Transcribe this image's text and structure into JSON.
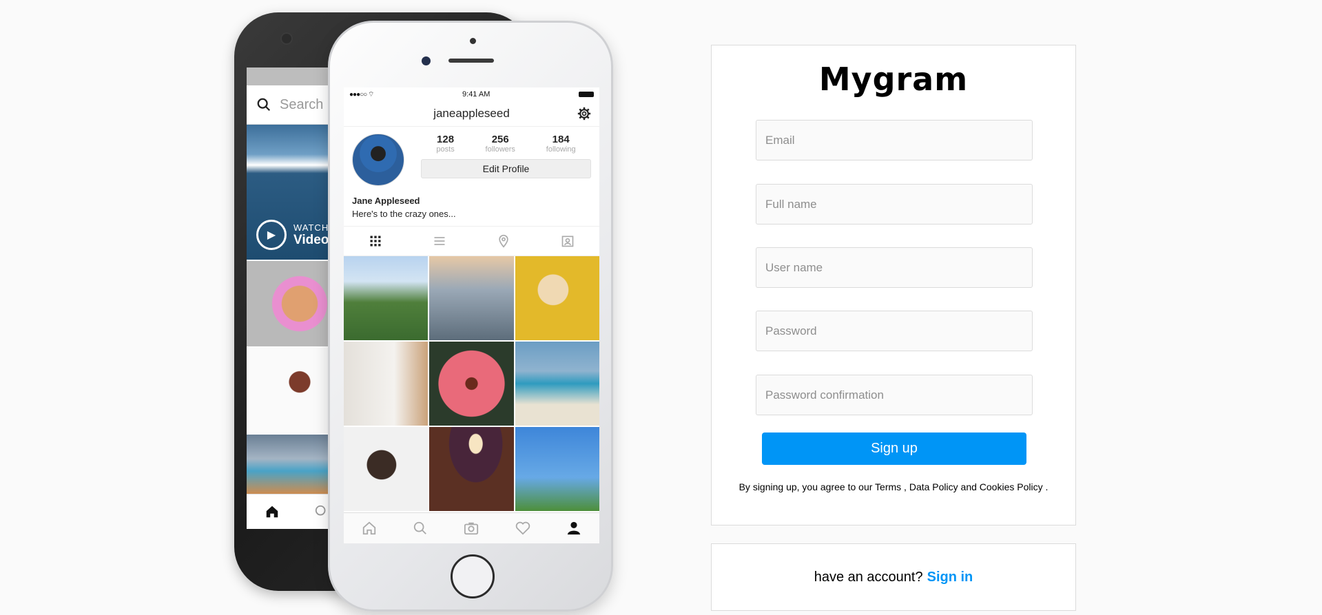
{
  "app": {
    "logo": "Mygram"
  },
  "phone_back": {
    "search_placeholder": "Search",
    "watch_small": "WATCH",
    "watch_big": "Video"
  },
  "phone_front": {
    "status": {
      "time": "9:41 AM"
    },
    "username": "janeappleseed",
    "stats": [
      {
        "value": "128",
        "label": "posts"
      },
      {
        "value": "256",
        "label": "followers"
      },
      {
        "value": "184",
        "label": "following"
      }
    ],
    "edit_profile": "Edit Profile",
    "name": "Jane Appleseed",
    "bio": "Here's to the crazy ones..."
  },
  "form": {
    "email_placeholder": "Email",
    "fullname_placeholder": "Full name",
    "username_placeholder": "User name",
    "password_placeholder": "Password",
    "password_confirm_placeholder": "Password confirmation",
    "signup_label": "Sign up",
    "terms_prefix": "By signing up, you agree to our ",
    "terms_link": "Terms",
    "terms_sep": " , ",
    "data_policy_link": "Data Policy",
    "and": " and ",
    "cookies_link": "Cookies Policy",
    "terms_suffix": " ."
  },
  "signin": {
    "prompt": "have an account?",
    "link": "Sign in"
  },
  "colors": {
    "accent": "#0095f6",
    "background": "#fafafa",
    "border": "#dbdbdb"
  }
}
